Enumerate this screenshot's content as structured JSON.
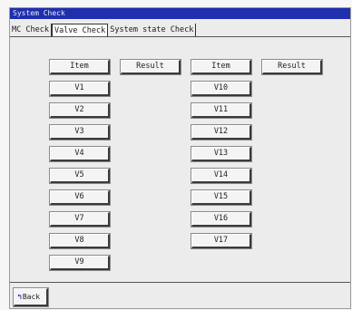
{
  "window": {
    "title": "System Check"
  },
  "tabs": [
    {
      "label": "MC Check",
      "active": false
    },
    {
      "label": "Valve Check",
      "active": true
    },
    {
      "label": "System state Check",
      "active": false
    }
  ],
  "columns": {
    "left": {
      "item_header": "Item",
      "result_header": "Result",
      "items": [
        "V1",
        "V2",
        "V3",
        "V4",
        "V5",
        "V6",
        "V7",
        "V8",
        "V9"
      ]
    },
    "right": {
      "item_header": "Item",
      "result_header": "Result",
      "items": [
        "V10",
        "V11",
        "V12",
        "V13",
        "V14",
        "V15",
        "V16",
        "V17"
      ]
    }
  },
  "footer": {
    "back_label": "Back",
    "back_icon": "back-arrow-icon"
  },
  "colors": {
    "titlebar": "#1f2fae",
    "background": "#ececec"
  }
}
